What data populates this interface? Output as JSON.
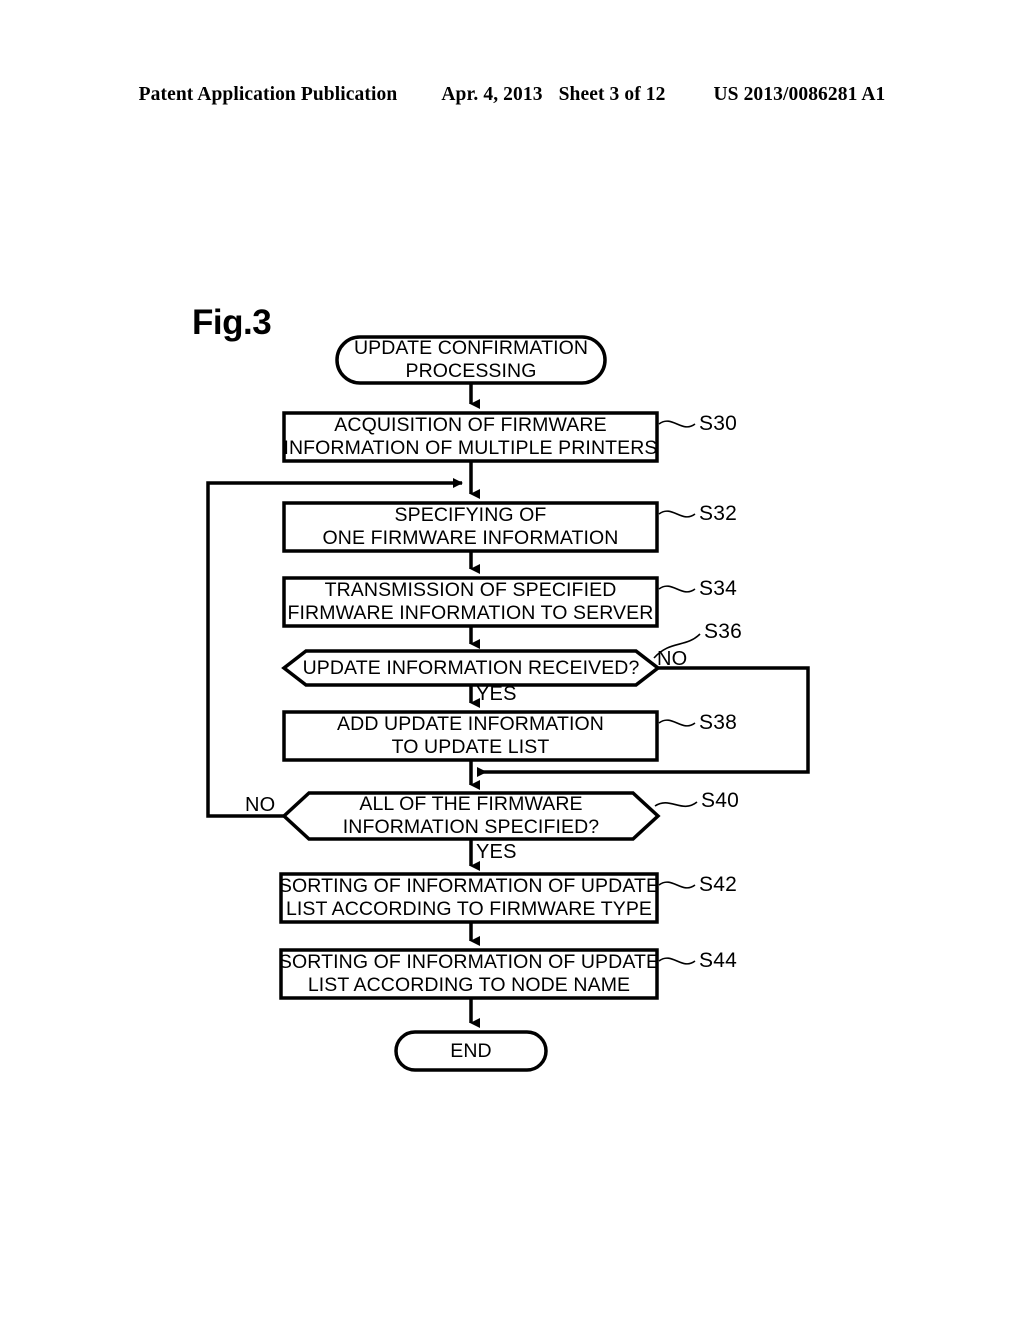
{
  "header": {
    "publication": "Patent Application Publication",
    "date": "Apr. 4, 2013",
    "sheet": "Sheet 3 of 12",
    "number": "US 2013/0086281 A1"
  },
  "figure": {
    "label": "Fig.3"
  },
  "flowchart": {
    "nodes": [
      {
        "id": "start",
        "shape": "stadium",
        "lines": [
          "UPDATE CONFIRMATION",
          "PROCESSING"
        ],
        "step": ""
      },
      {
        "id": "s30",
        "shape": "process",
        "lines": [
          "ACQUISITION OF FIRMWARE",
          "INFORMATION OF MULTIPLE PRINTERS"
        ],
        "step": "S30"
      },
      {
        "id": "s32",
        "shape": "process",
        "lines": [
          "SPECIFYING OF",
          "ONE FIRMWARE INFORMATION"
        ],
        "step": "S32"
      },
      {
        "id": "s34",
        "shape": "process",
        "lines": [
          "TRANSMISSION OF SPECIFIED",
          "FIRMWARE INFORMATION TO SERVER"
        ],
        "step": "S34"
      },
      {
        "id": "s36",
        "shape": "decision",
        "lines": [
          "UPDATE INFORMATION RECEIVED?"
        ],
        "step": "S36"
      },
      {
        "id": "s38",
        "shape": "process",
        "lines": [
          "ADD UPDATE INFORMATION",
          "TO UPDATE LIST"
        ],
        "step": "S38"
      },
      {
        "id": "s40",
        "shape": "decision",
        "lines": [
          "ALL OF THE FIRMWARE",
          "INFORMATION SPECIFIED?"
        ],
        "step": "S40"
      },
      {
        "id": "s42",
        "shape": "process",
        "lines": [
          "SORTING OF INFORMATION OF UPDATE",
          "LIST ACCORDING TO FIRMWARE TYPE"
        ],
        "step": "S42"
      },
      {
        "id": "s44",
        "shape": "process",
        "lines": [
          "SORTING OF INFORMATION OF UPDATE",
          "LIST ACCORDING TO NODE NAME"
        ],
        "step": "S44"
      },
      {
        "id": "end",
        "shape": "stadium",
        "lines": [
          "END"
        ],
        "step": ""
      }
    ],
    "branch_labels": {
      "s36_no": "NO",
      "s36_yes": "YES",
      "s40_no": "NO",
      "s40_yes": "YES"
    },
    "colors": {
      "stroke": "#000000",
      "fill": "#ffffff",
      "background": "#ffffff"
    }
  }
}
